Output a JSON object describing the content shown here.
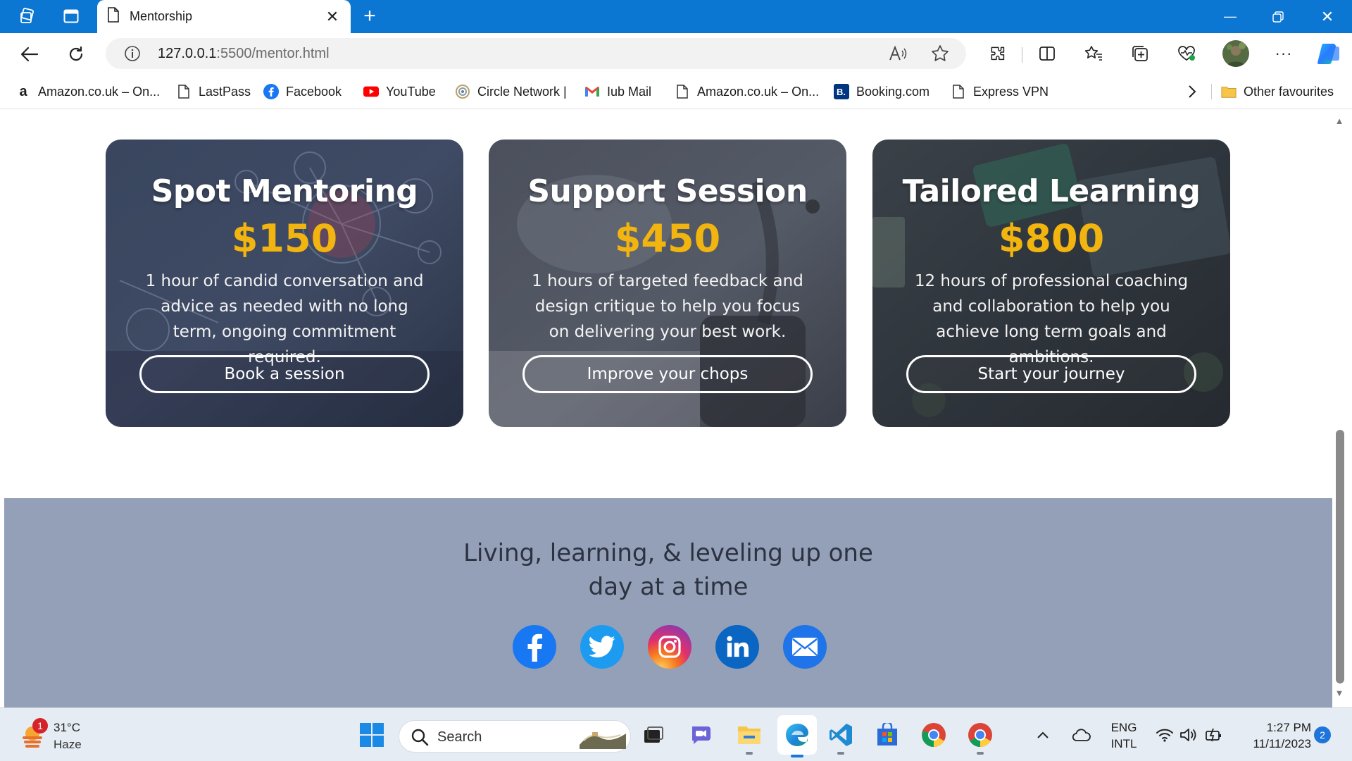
{
  "browser": {
    "tab_title": "Mentorship",
    "url_host": "127.0.0.1",
    "url_path": ":5500/mentor.html",
    "bookmarks": [
      {
        "label": "Amazon.co.uk – On..."
      },
      {
        "label": "LastPass"
      },
      {
        "label": "Facebook"
      },
      {
        "label": "YouTube"
      },
      {
        "label": "Circle Network |"
      },
      {
        "label": "Iub Mail"
      },
      {
        "label": "Amazon.co.uk – On..."
      },
      {
        "label": "Booking.com"
      },
      {
        "label": "Express VPN"
      }
    ],
    "other_favourites": "Other favourites"
  },
  "pricing": [
    {
      "title": "Spot Mentoring",
      "price": "$150",
      "description": "1 hour of candid conversation and advice as needed with no long term, ongoing commitment required.",
      "cta": "Book a session"
    },
    {
      "title": "Support Session",
      "price": "$450",
      "description": "1 hours of targeted feedback and design critique to help you focus on delivering your best work.",
      "cta": "Improve your chops"
    },
    {
      "title": "Tailored Learning",
      "price": "$800",
      "description": "12 hours of professional coaching and collaboration to help you achieve long term goals and ambitions.",
      "cta": "Start your journey"
    }
  ],
  "footer": {
    "tagline_line1": "Living, learning, & leveling up one",
    "tagline_line2": "day at a time",
    "social": [
      "facebook-icon",
      "twitter-icon",
      "instagram-icon",
      "linkedin-icon",
      "email-icon"
    ]
  },
  "taskbar": {
    "weather_temp": "31°C",
    "weather_desc": "Haze",
    "weather_badge": "1",
    "search_placeholder": "Search",
    "lang_line1": "ENG",
    "lang_line2": "INTL",
    "time": "1:27 PM",
    "date": "11/11/2023",
    "notification_count": "2"
  },
  "colors": {
    "titlebar": "#0c77d3",
    "price_gold": "#f2b40f",
    "footer_bg": "#93a0b8"
  }
}
